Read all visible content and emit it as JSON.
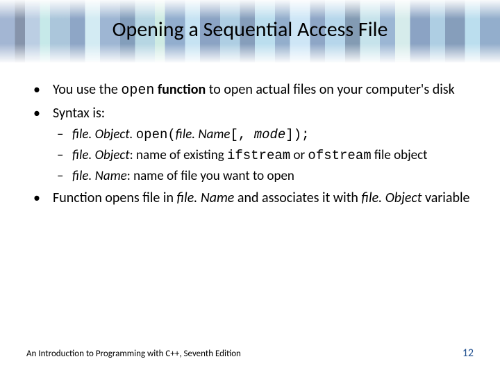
{
  "title": "Opening a Sequential Access File",
  "bullets": {
    "b1_pre": "You use the ",
    "b1_code": "open",
    "b1_bold": " function",
    "b1_post": " to open actual files on your computer's disk",
    "b2": "Syntax is:",
    "b2a_ital1": "file. Object. ",
    "b2a_code1": "open(",
    "b2a_ital2": "file. Name",
    "b2a_code2": "[, ",
    "b2a_ital3": "mode",
    "b2a_code3": "]);",
    "b2b_ital": "file. Object",
    "b2b_mid": ": name of existing ",
    "b2b_code1": "ifstream",
    "b2b_or": " or ",
    "b2b_code2": "ofstream",
    "b2b_post": " file object",
    "b2c_ital": "file. Name",
    "b2c_post": ": name of file you want to open",
    "b3_pre": "Function opens file in ",
    "b3_ital1": "file. Name",
    "b3_mid": " and associates it with ",
    "b3_ital2": "file. Object",
    "b3_post": " variable"
  },
  "footer": {
    "book": "An Introduction to Programming with C++, Seventh Edition",
    "page": "12"
  }
}
